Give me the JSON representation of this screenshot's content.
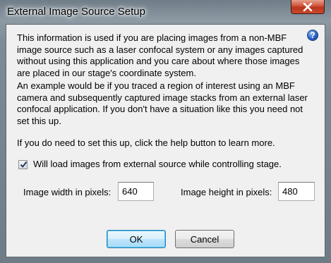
{
  "dialog": {
    "title": "External Image Source Setup",
    "close_icon": "close-icon",
    "help_icon": "help-icon",
    "help_glyph": "?"
  },
  "content": {
    "paragraph_1": "This information is used if you are placing images from a non-MBF image source such as a laser confocal system or any images captured without using this application and you care about where those images are placed in our stage's coordinate system.",
    "paragraph_2": "An example would be if you traced a region of interest using an MBF camera and subsequently captured image stacks from an external laser confocal application.  If you don't have a situation like this you need not set this up.",
    "paragraph_3": "If you do need to set this up, click the help button to learn more."
  },
  "checkbox": {
    "label": "Will load images from external source while controlling stage.",
    "checked": true
  },
  "fields": {
    "width_label": "Image width in pixels:",
    "width_value": "640",
    "height_label": "Image height in pixels:",
    "height_value": "480"
  },
  "buttons": {
    "ok_label": "OK",
    "cancel_label": "Cancel"
  },
  "colors": {
    "close_button": "#c94a2c",
    "help_icon": "#2a62c9",
    "ok_button_border": "#3c7fb1"
  }
}
